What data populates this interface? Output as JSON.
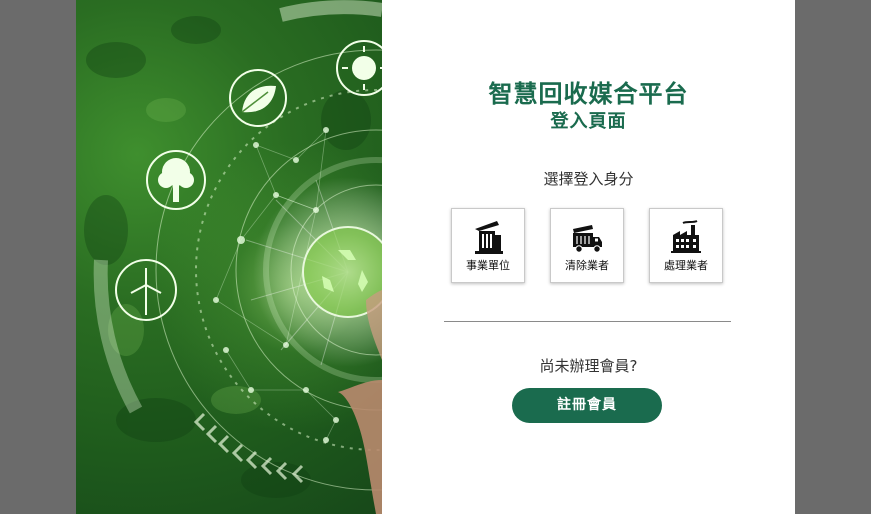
{
  "brand": {
    "accent": "#1a6b4e"
  },
  "login": {
    "title": "智慧回收媒合平台",
    "subtitle": "登入頁面",
    "choose_prompt": "選擇登入身分",
    "roles": [
      {
        "label": "事業單位",
        "icon": "office-building-icon"
      },
      {
        "label": "清除業者",
        "icon": "garbage-truck-icon"
      },
      {
        "label": "處理業者",
        "icon": "factory-icon"
      }
    ],
    "not_member_text": "尚未辦理會員?",
    "register_label": "註冊會員"
  },
  "hero": {
    "icons": [
      "leaf-icon",
      "sun-icon",
      "tree-icon",
      "wind-turbine-icon",
      "recycle-icon"
    ]
  }
}
